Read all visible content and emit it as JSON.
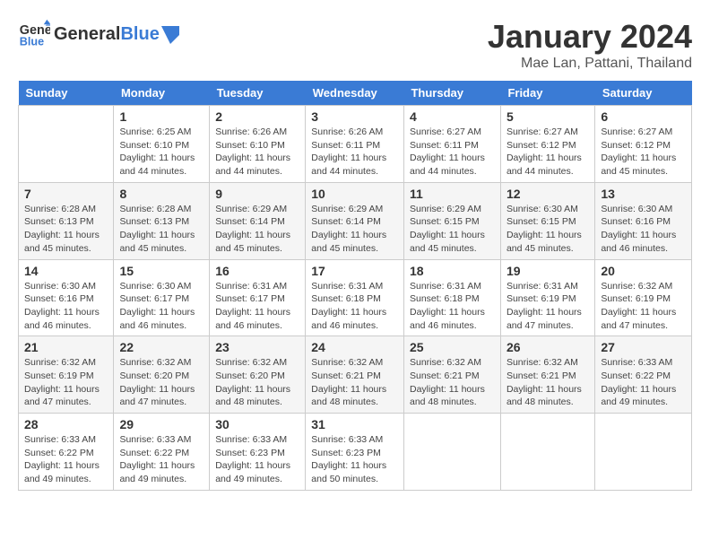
{
  "header": {
    "logo_general": "General",
    "logo_blue": "Blue",
    "month": "January 2024",
    "location": "Mae Lan, Pattani, Thailand"
  },
  "weekdays": [
    "Sunday",
    "Monday",
    "Tuesday",
    "Wednesday",
    "Thursday",
    "Friday",
    "Saturday"
  ],
  "weeks": [
    [
      {
        "day": "",
        "info": ""
      },
      {
        "day": "1",
        "info": "Sunrise: 6:25 AM\nSunset: 6:10 PM\nDaylight: 11 hours\nand 44 minutes."
      },
      {
        "day": "2",
        "info": "Sunrise: 6:26 AM\nSunset: 6:10 PM\nDaylight: 11 hours\nand 44 minutes."
      },
      {
        "day": "3",
        "info": "Sunrise: 6:26 AM\nSunset: 6:11 PM\nDaylight: 11 hours\nand 44 minutes."
      },
      {
        "day": "4",
        "info": "Sunrise: 6:27 AM\nSunset: 6:11 PM\nDaylight: 11 hours\nand 44 minutes."
      },
      {
        "day": "5",
        "info": "Sunrise: 6:27 AM\nSunset: 6:12 PM\nDaylight: 11 hours\nand 44 minutes."
      },
      {
        "day": "6",
        "info": "Sunrise: 6:27 AM\nSunset: 6:12 PM\nDaylight: 11 hours\nand 45 minutes."
      }
    ],
    [
      {
        "day": "7",
        "info": "Sunrise: 6:28 AM\nSunset: 6:13 PM\nDaylight: 11 hours\nand 45 minutes."
      },
      {
        "day": "8",
        "info": "Sunrise: 6:28 AM\nSunset: 6:13 PM\nDaylight: 11 hours\nand 45 minutes."
      },
      {
        "day": "9",
        "info": "Sunrise: 6:29 AM\nSunset: 6:14 PM\nDaylight: 11 hours\nand 45 minutes."
      },
      {
        "day": "10",
        "info": "Sunrise: 6:29 AM\nSunset: 6:14 PM\nDaylight: 11 hours\nand 45 minutes."
      },
      {
        "day": "11",
        "info": "Sunrise: 6:29 AM\nSunset: 6:15 PM\nDaylight: 11 hours\nand 45 minutes."
      },
      {
        "day": "12",
        "info": "Sunrise: 6:30 AM\nSunset: 6:15 PM\nDaylight: 11 hours\nand 45 minutes."
      },
      {
        "day": "13",
        "info": "Sunrise: 6:30 AM\nSunset: 6:16 PM\nDaylight: 11 hours\nand 46 minutes."
      }
    ],
    [
      {
        "day": "14",
        "info": "Sunrise: 6:30 AM\nSunset: 6:16 PM\nDaylight: 11 hours\nand 46 minutes."
      },
      {
        "day": "15",
        "info": "Sunrise: 6:30 AM\nSunset: 6:17 PM\nDaylight: 11 hours\nand 46 minutes."
      },
      {
        "day": "16",
        "info": "Sunrise: 6:31 AM\nSunset: 6:17 PM\nDaylight: 11 hours\nand 46 minutes."
      },
      {
        "day": "17",
        "info": "Sunrise: 6:31 AM\nSunset: 6:18 PM\nDaylight: 11 hours\nand 46 minutes."
      },
      {
        "day": "18",
        "info": "Sunrise: 6:31 AM\nSunset: 6:18 PM\nDaylight: 11 hours\nand 46 minutes."
      },
      {
        "day": "19",
        "info": "Sunrise: 6:31 AM\nSunset: 6:19 PM\nDaylight: 11 hours\nand 47 minutes."
      },
      {
        "day": "20",
        "info": "Sunrise: 6:32 AM\nSunset: 6:19 PM\nDaylight: 11 hours\nand 47 minutes."
      }
    ],
    [
      {
        "day": "21",
        "info": "Sunrise: 6:32 AM\nSunset: 6:19 PM\nDaylight: 11 hours\nand 47 minutes."
      },
      {
        "day": "22",
        "info": "Sunrise: 6:32 AM\nSunset: 6:20 PM\nDaylight: 11 hours\nand 47 minutes."
      },
      {
        "day": "23",
        "info": "Sunrise: 6:32 AM\nSunset: 6:20 PM\nDaylight: 11 hours\nand 48 minutes."
      },
      {
        "day": "24",
        "info": "Sunrise: 6:32 AM\nSunset: 6:21 PM\nDaylight: 11 hours\nand 48 minutes."
      },
      {
        "day": "25",
        "info": "Sunrise: 6:32 AM\nSunset: 6:21 PM\nDaylight: 11 hours\nand 48 minutes."
      },
      {
        "day": "26",
        "info": "Sunrise: 6:32 AM\nSunset: 6:21 PM\nDaylight: 11 hours\nand 48 minutes."
      },
      {
        "day": "27",
        "info": "Sunrise: 6:33 AM\nSunset: 6:22 PM\nDaylight: 11 hours\nand 49 minutes."
      }
    ],
    [
      {
        "day": "28",
        "info": "Sunrise: 6:33 AM\nSunset: 6:22 PM\nDaylight: 11 hours\nand 49 minutes."
      },
      {
        "day": "29",
        "info": "Sunrise: 6:33 AM\nSunset: 6:22 PM\nDaylight: 11 hours\nand 49 minutes."
      },
      {
        "day": "30",
        "info": "Sunrise: 6:33 AM\nSunset: 6:23 PM\nDaylight: 11 hours\nand 49 minutes."
      },
      {
        "day": "31",
        "info": "Sunrise: 6:33 AM\nSunset: 6:23 PM\nDaylight: 11 hours\nand 50 minutes."
      },
      {
        "day": "",
        "info": ""
      },
      {
        "day": "",
        "info": ""
      },
      {
        "day": "",
        "info": ""
      }
    ]
  ]
}
